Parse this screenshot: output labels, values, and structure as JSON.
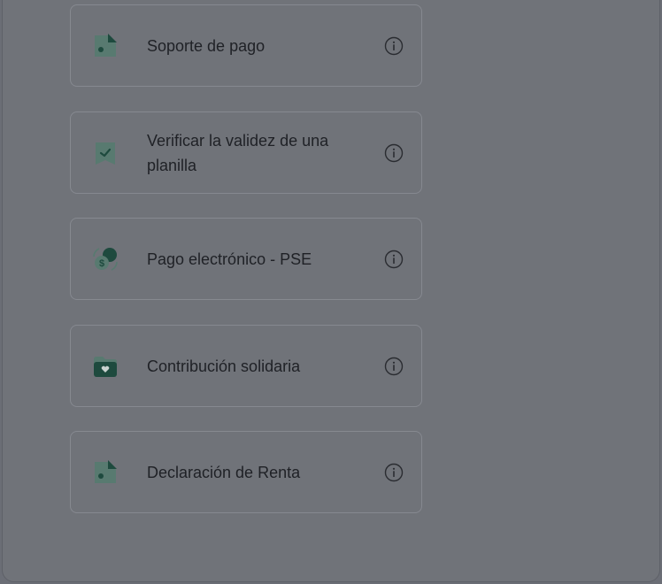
{
  "services": [
    {
      "label": "Soporte de pago",
      "icon": "document-icon"
    },
    {
      "label": "Verificar la validez de una planilla",
      "icon": "bookmark-check-icon"
    },
    {
      "label": "Pago electrónico - PSE",
      "icon": "currency-exchange-icon"
    },
    {
      "label": "Contribución solidaria",
      "icon": "folder-heart-icon"
    },
    {
      "label": "Declaración de Renta",
      "icon": "document-icon"
    }
  ],
  "colors": {
    "overlay_bg": "#6b6e76",
    "icon_dark": "#1e4a3e",
    "icon_light": "#587a70",
    "text": "#1f2126"
  }
}
